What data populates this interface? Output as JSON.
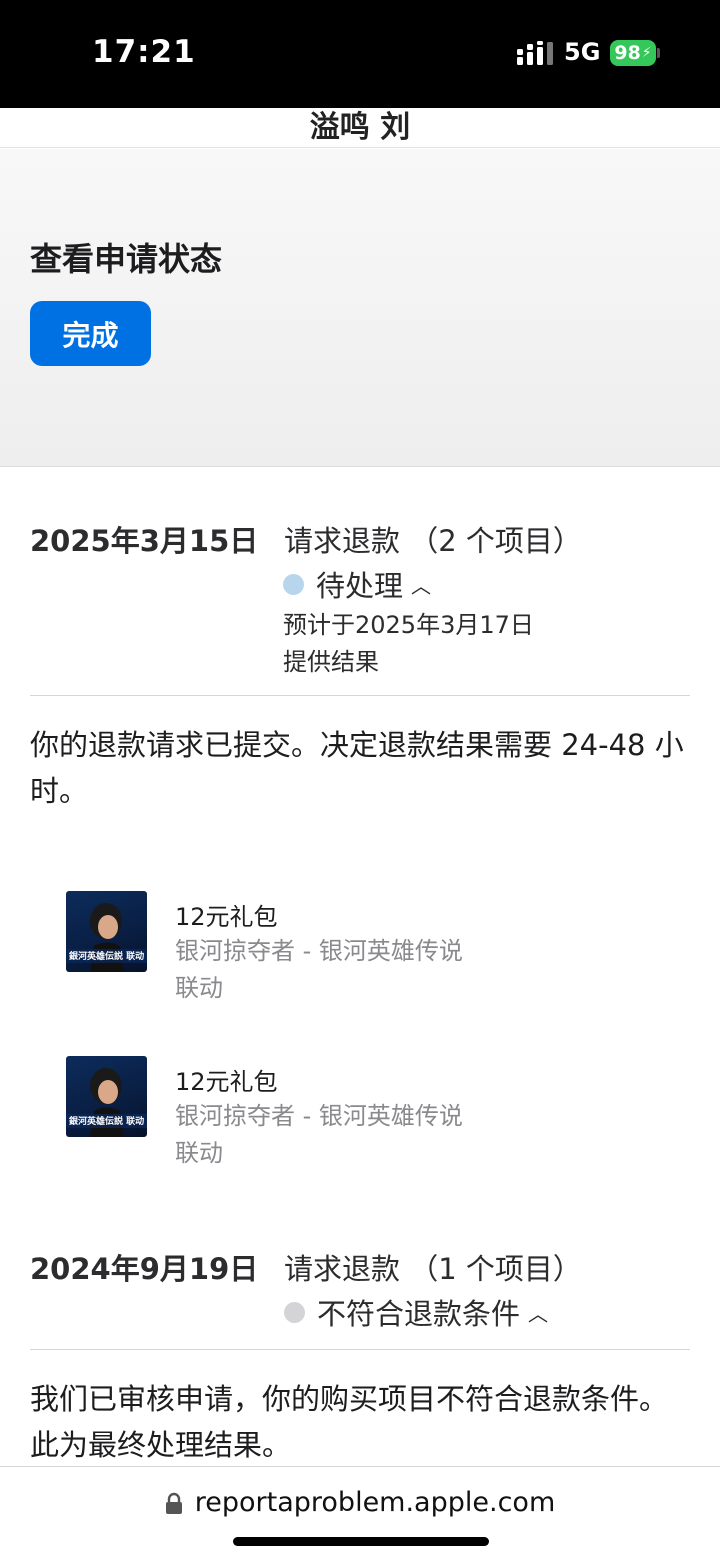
{
  "status_bar": {
    "time": "17:21",
    "network": "5G",
    "battery": "98"
  },
  "header": {
    "name": "溢鸣 刘"
  },
  "panel": {
    "title": "查看申请状态",
    "done_label": "完成"
  },
  "requests": [
    {
      "date": "2025年3月15日",
      "title": "请求退款 （2 个项目）",
      "status": "待处理",
      "status_color": "#b7d6ee",
      "eta_line1": "预计于2025年3月17日",
      "eta_line2": "提供结果",
      "message": "你的退款请求已提交。决定退款结果需要 24-48 小时。",
      "items": [
        {
          "name": "12元礼包",
          "app_line1": "银河掠夺者 - 银河英雄传说",
          "app_line2": "联动",
          "thumb_text": "銀河英雄伝説 联动"
        },
        {
          "name": "12元礼包",
          "app_line1": "银河掠夺者 - 银河英雄传说",
          "app_line2": "联动",
          "thumb_text": "銀河英雄伝説 联动"
        }
      ]
    },
    {
      "date": "2024年9月19日",
      "title": "请求退款 （1 个项目）",
      "status": "不符合退款条件",
      "status_color": "#d4d4d6",
      "message": "我们已审核申请，你的购买项目不符合退款条件。此为最终处理结果。"
    }
  ],
  "browser": {
    "url": "reportaproblem.apple.com"
  },
  "colors": {
    "accent": "#0071e3",
    "battery": "#34c759"
  }
}
